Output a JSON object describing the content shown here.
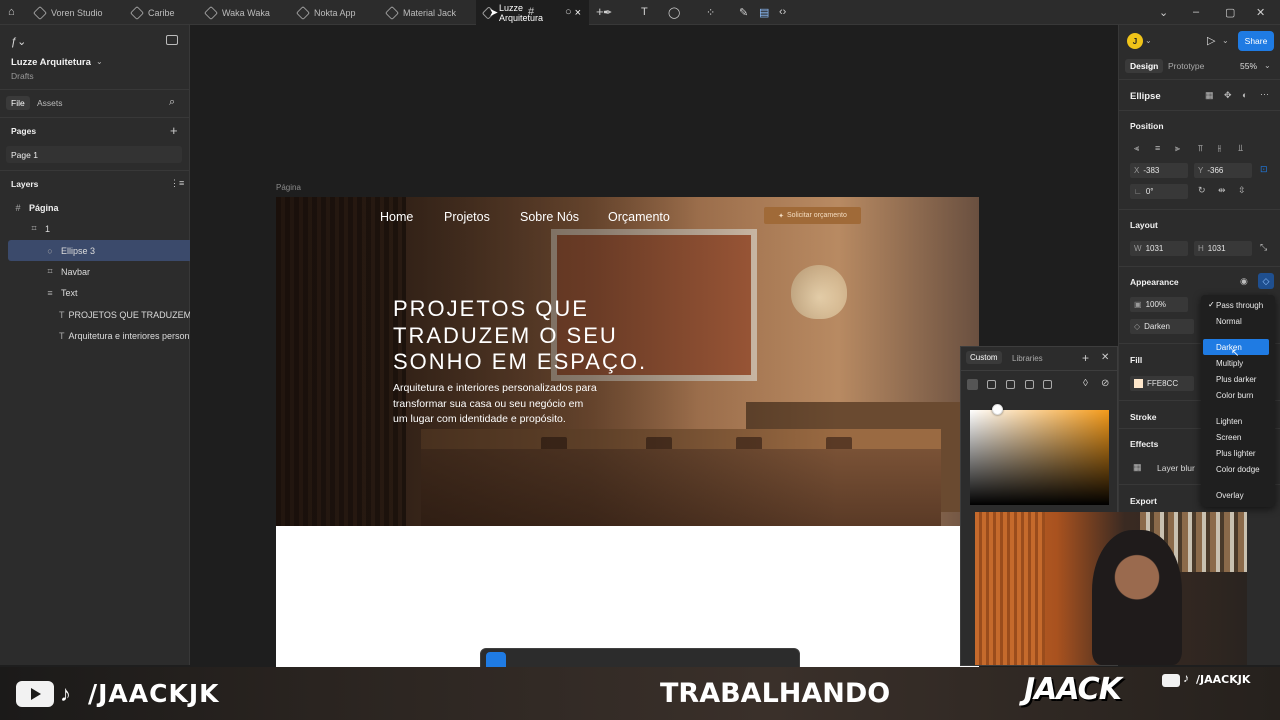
{
  "tabs": [
    {
      "label": "Voren Studio"
    },
    {
      "label": "Caribe"
    },
    {
      "label": "Waka Waka"
    },
    {
      "label": "Nokta App"
    },
    {
      "label": "Material Jack"
    },
    {
      "label": "Luzze Arquitetura"
    }
  ],
  "left_panel": {
    "project_title": "Luzze Arquitetura",
    "project_sub": "Drafts",
    "file_tab": "File",
    "assets_tab": "Assets",
    "pages_heading": "Pages",
    "page_item": "Page 1",
    "layers_heading": "Layers",
    "layers": [
      {
        "label": "Página"
      },
      {
        "label": "1"
      },
      {
        "label": "Ellipse 3"
      },
      {
        "label": "Navbar"
      },
      {
        "label": "Text"
      },
      {
        "label": "PROJETOS QUE TRADUZEM O S"
      },
      {
        "label": "Arquitetura e interiores personal"
      }
    ]
  },
  "canvas": {
    "frame_label": "Página",
    "nav": [
      "Home",
      "Projetos",
      "Sobre Nós",
      "Orçamento"
    ],
    "cta": "Solicitar orçamento",
    "hero_title_lines": [
      "PROJETOS QUE",
      "TRADUZEM O SEU",
      "SONHO EM ESPAÇO."
    ],
    "hero_sub_lines": [
      "Arquitetura e interiores personalizados para",
      "transformar sua casa ou seu negócio em",
      "um lugar com identidade e propósito."
    ]
  },
  "right_panel": {
    "avatar_letter": "J",
    "share": "Share",
    "design_tab": "Design",
    "prototype_tab": "Prototype",
    "zoom": "55%",
    "layer_name": "Ellipse",
    "position_heading": "Position",
    "x_label": "X",
    "x_value": "-383",
    "y_label": "Y",
    "y_value": "-366",
    "rotation": "0°",
    "layout_heading": "Layout",
    "w_label": "W",
    "w_value": "1031",
    "h_label": "H",
    "h_value": "1031",
    "appearance_heading": "Appearance",
    "opacity": "100%",
    "blend_mode": "Darken",
    "fill_heading": "Fill",
    "fill_hex": "FFE8CC",
    "stroke_heading": "Stroke",
    "effects_heading": "Effects",
    "effect_item": "Layer blur",
    "export_heading": "Export"
  },
  "blend_menu": {
    "items": [
      "Pass through",
      "Normal",
      "Darken",
      "Multiply",
      "Plus darker",
      "Color burn",
      "Lighten",
      "Screen",
      "Plus lighter",
      "Color dodge",
      "Overlay"
    ],
    "checked": "Pass through",
    "highlighted": "Darken"
  },
  "color_picker": {
    "tab_custom": "Custom",
    "tab_libraries": "Libraries"
  },
  "banner": {
    "left_handle": "/JAACKJK",
    "center_text": "TRABALHANDO",
    "logo": "JAACK",
    "right_handle": "/JAACKJK"
  },
  "colors": {
    "accent": "#1f7be3",
    "panel": "#2c2c2c",
    "canvas": "#1e1e1e"
  }
}
